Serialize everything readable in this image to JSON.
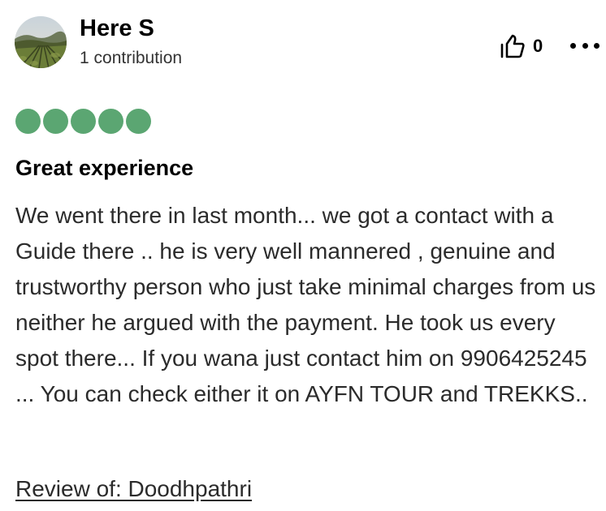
{
  "user": {
    "name": "Here S",
    "contributions": "1 contribution",
    "avatar_icon": "vineyard-landscape-avatar"
  },
  "actions": {
    "helpful_icon": "thumbs-up-icon",
    "helpful_count": "0",
    "more_icon": "more-options-icon"
  },
  "rating": {
    "value": 5,
    "max": 5,
    "color": "#5ba672"
  },
  "review": {
    "title": "Great experience",
    "body": "We went there in last month... we got a contact with a Guide there .. he is very well mannered , genuine and trustworthy person who just take minimal charges from us neither he argued with the payment. He took us every spot there... If you wana just contact him on 9906425245 ... You can check either it on AYFN TOUR and TREKKS..",
    "review_of": "Review of: Doodhpathri"
  }
}
